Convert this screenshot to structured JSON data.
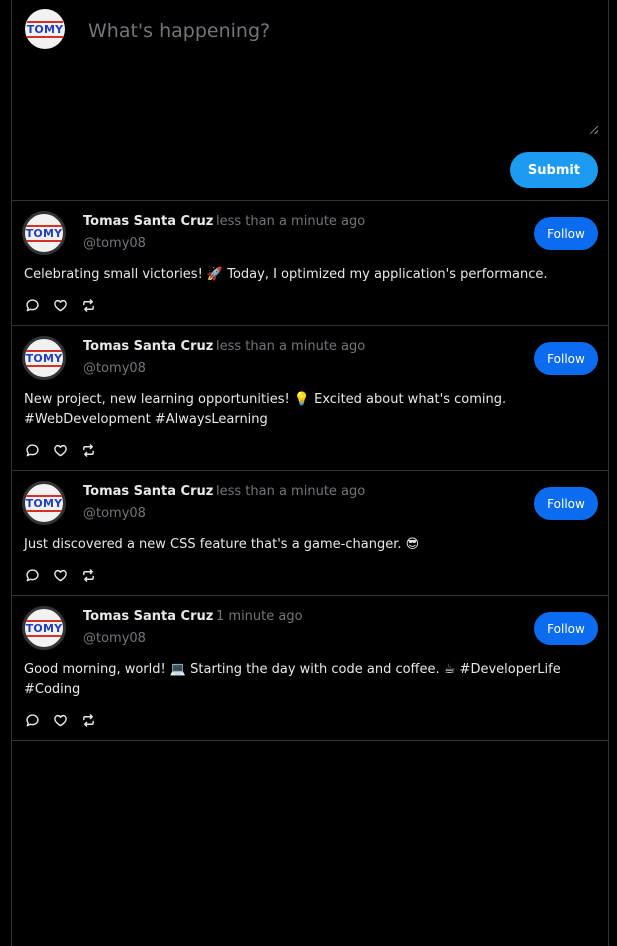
{
  "composer": {
    "placeholder": "What's happening?",
    "submit_label": "Submit",
    "avatar_text": "TOMY"
  },
  "posts": [
    {
      "name": "Tomas Santa Cruz",
      "handle": "@tomy08",
      "time": "less than a minute ago",
      "follow_label": "Follow",
      "avatar_text": "TOMY",
      "text": "Celebrating small victories! 🚀 Today, I optimized my application's performance."
    },
    {
      "name": "Tomas Santa Cruz",
      "handle": "@tomy08",
      "time": "less than a minute ago",
      "follow_label": "Follow",
      "avatar_text": "TOMY",
      "text": "New project, new learning opportunities! 💡 Excited about what's coming. #WebDevelopment #AlwaysLearning"
    },
    {
      "name": "Tomas Santa Cruz",
      "handle": "@tomy08",
      "time": "less than a minute ago",
      "follow_label": "Follow",
      "avatar_text": "TOMY",
      "text": "Just discovered a new CSS feature that's a game-changer. 😎"
    },
    {
      "name": "Tomas Santa Cruz",
      "handle": "@tomy08",
      "time": "1 minute ago",
      "follow_label": "Follow",
      "avatar_text": "TOMY",
      "text": "Good morning, world! 💻 Starting the day with code and coffee. ☕ #DeveloperLife #Coding"
    }
  ],
  "icons": {
    "reply": "comment-icon",
    "like": "heart-icon",
    "repost": "repost-icon"
  },
  "colors": {
    "background": "#000000",
    "submit": "#1d9bf0",
    "follow": "#0b6cf0",
    "muted": "#71767b",
    "border": "#2f3336"
  }
}
